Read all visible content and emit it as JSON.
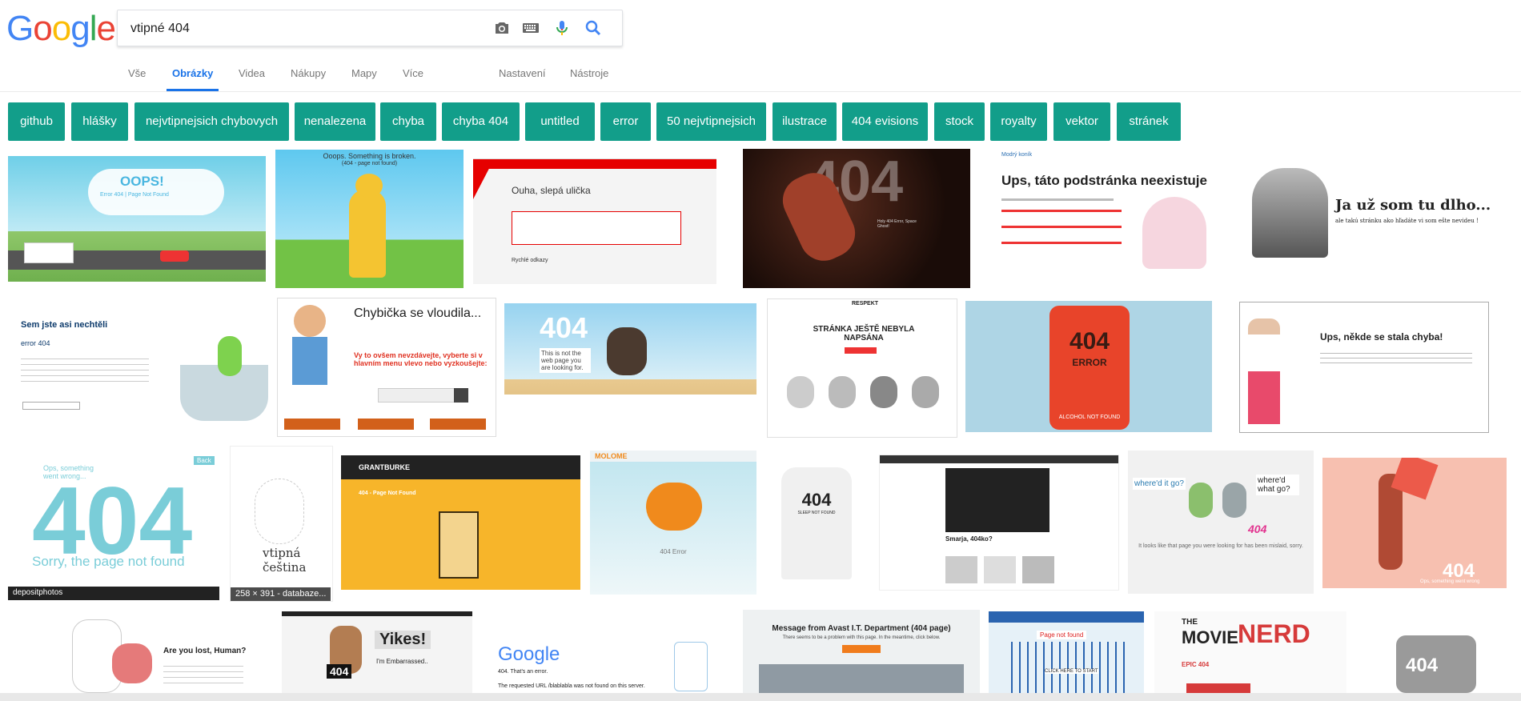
{
  "search": {
    "query": "vtipné 404"
  },
  "logo": {
    "letters": [
      "G",
      "o",
      "o",
      "g",
      "l",
      "e"
    ],
    "colors": [
      "#4285f4",
      "#ea4335",
      "#fbbc05",
      "#4285f4",
      "#34a853",
      "#ea4335"
    ]
  },
  "tabs": {
    "all": "Vše",
    "images": "Obrázky",
    "videos": "Videa",
    "shopping": "Nákupy",
    "maps": "Mapy",
    "more": "Více",
    "settings": "Nastavení",
    "tools": "Nástroje"
  },
  "chips": [
    "github",
    "hlášky",
    "nejvtipnejsich chybovych",
    "nenalezena",
    "chyba",
    "chyba 404",
    "untitled",
    "error",
    "50 nejvtipnejsich",
    "ilustrace",
    "404 evisions",
    "stock",
    "royalty",
    "vektor",
    "stránek"
  ],
  "results": {
    "r1": {
      "oops": "OOPS!",
      "sub": "Error 404 | Page Not Found"
    },
    "r2": {
      "head": "Ooops. Something is broken.",
      "sub": "(404 - page not found)"
    },
    "r3": {
      "title": "Ouha, slepá ulička",
      "sub": "Rychlé odkazy"
    },
    "r4": {
      "big": "404",
      "caption": "Holy 404 Error, Space Ghost!"
    },
    "r5": {
      "brand": "Modrý koník",
      "title": "Ups, táto podstránka neexistuje"
    },
    "r6": {
      "title": "Ja už som tu dlho...",
      "sub": "ale takú stránku ako hľadáte vi som ešte nevideu !"
    },
    "r7": {
      "title": "Sem jste asi nechtěli",
      "sub": "error 404"
    },
    "r8": {
      "title": "Chybička se vloudila...",
      "warn": "Vy to ovšem nevzdávejte, vyberte si v hlavním menu vlevo nebo vyzkoušejte:"
    },
    "r9": {
      "big": "404",
      "sub": "This is not the web page you are looking for."
    },
    "r10": {
      "brand": "RESPEKT",
      "title": "STRÁNKA JEŠTĚ NEBYLA NAPSÁNA"
    },
    "r11": {
      "big": "404",
      "err": "ERROR",
      "sub": "ALCOHOL NOT FOUND"
    },
    "r12": {
      "title": "Ups, někde se stala chyba!"
    },
    "r13": {
      "top": "Ops, something went wrong...",
      "big": "404",
      "sub": "Sorry, the page not found",
      "brand": "depositphotos",
      "back": "Back"
    },
    "r14": {
      "word": "vtipná čeština",
      "dims": "258 × 391 - databaze..."
    },
    "r15": {
      "brand": "GRANTBURKE",
      "sub": "404 - Page Not Found"
    },
    "r16": {
      "brand": "MOLOME",
      "sub": "404 Error"
    },
    "r17": {
      "big": "404",
      "sub": "SLEEP NOT FOUND"
    },
    "r18": {
      "title": "Smarja, 404ko?"
    },
    "r19": {
      "q1": "where'd it go?",
      "q2": "where'd what go?",
      "big": "404",
      "sub": "It looks like that page you were looking for has been mislaid, sorry."
    },
    "r20": {
      "big": "404",
      "sub": "Ops, something went wrong"
    },
    "r21": {
      "title": "Are you lost, Human?"
    },
    "r22": {
      "title": "Yikes!",
      "sub": "I'm Embarrassed..",
      "sign": "404"
    },
    "r23": {
      "brand": "Google",
      "sub": "404. That's an error.",
      "sub2": "The requested URL /blablabla was not found on this server."
    },
    "r24": {
      "title": "Message from Avast I.T. Department (404 page)",
      "sub": "There seems to be a problem with this page. In the meantime, click below."
    },
    "r25": {
      "title": "Page not found",
      "sub": "CLICK HERE TO START"
    },
    "r26": {
      "brand1": "THE",
      "brand2": "MOVIE",
      "brand3": "NERD",
      "sub": "EPIC 404"
    },
    "r27": {
      "big": "404"
    }
  }
}
